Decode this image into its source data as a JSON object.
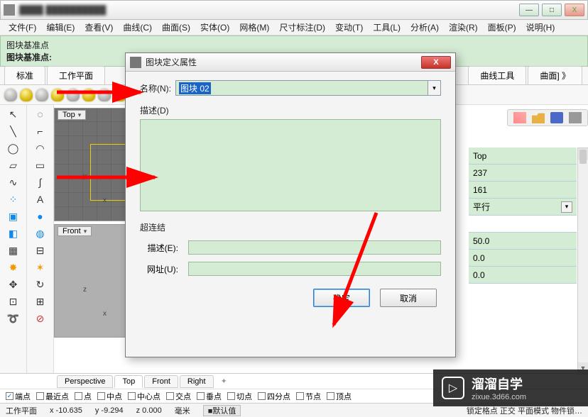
{
  "window": {
    "min": "—",
    "max": "□",
    "close": "X"
  },
  "menus": [
    "文件(F)",
    "编辑(E)",
    "查看(V)",
    "曲线(C)",
    "曲面(S)",
    "实体(O)",
    "网格(M)",
    "尺寸标注(D)",
    "变动(T)",
    "工具(L)",
    "分析(A)",
    "渲染(R)",
    "面板(P)",
    "说明(H)"
  ],
  "cmd": {
    "line1": "图块基准点",
    "line2": "图块基准点:"
  },
  "tabs": {
    "left": [
      "标准",
      "工作平面"
    ],
    "right": [
      "曲线工具",
      "曲面] 》"
    ]
  },
  "viewports": {
    "top": "Top",
    "front": "Front"
  },
  "dialog": {
    "title": "图块定义属性",
    "name_label": "名称(N):",
    "name_value": "图块 02",
    "desc_label": "描述(D)",
    "link_label": "超连结",
    "desc_field": "描述(E):",
    "url_field": "网址(U):",
    "ok": "确定",
    "cancel": "取消"
  },
  "props": {
    "r1": "Top",
    "r2": "237",
    "r3": "161",
    "r4": "平行",
    "r5": "50.0",
    "r6": "0.0",
    "r7": "0.0"
  },
  "vtabs": [
    "Perspective",
    "Top",
    "Front",
    "Right"
  ],
  "osnaps": [
    {
      "label": "端点",
      "checked": true
    },
    {
      "label": "最近点",
      "checked": false
    },
    {
      "label": "点",
      "checked": false
    },
    {
      "label": "中点",
      "checked": false
    },
    {
      "label": "中心点",
      "checked": false
    },
    {
      "label": "交点",
      "checked": false
    },
    {
      "label": "垂点",
      "checked": false
    },
    {
      "label": "切点",
      "checked": false
    },
    {
      "label": "四分点",
      "checked": false
    },
    {
      "label": "节点",
      "checked": false
    },
    {
      "label": "顶点",
      "checked": false
    }
  ],
  "status": {
    "plane": "工作平面",
    "x": "x -10.635",
    "y": "y -9.294",
    "z": "z 0.000",
    "unit": "毫米",
    "layer": "■默认值",
    "right": "锁定格点 正交  平面模式 物件锁…"
  },
  "watermark": {
    "brand": "溜溜自学",
    "url": "zixue.3d66.com",
    "play": "▷"
  }
}
